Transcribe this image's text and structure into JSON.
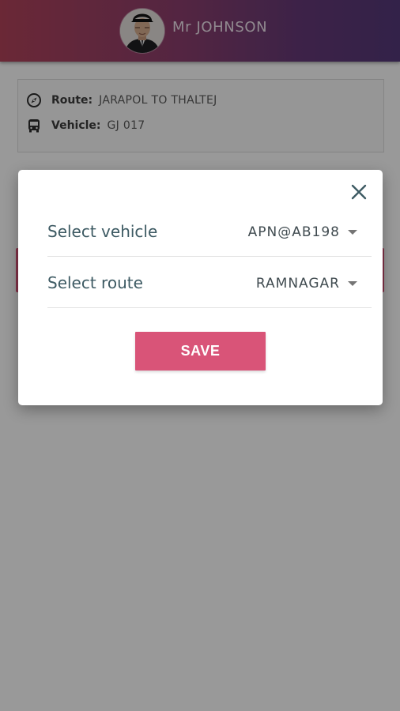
{
  "header": {
    "user_name": "Mr JOHNSON",
    "avatar_icon": "user-avatar-photo",
    "gradient_colors": [
      "#b2435b",
      "#553a7a"
    ]
  },
  "trip": {
    "route_icon": "compass-icon",
    "route_label": "Route:",
    "route_value": "JARAPOL TO THALTEJ",
    "vehicle_icon": "bus-icon",
    "vehicle_label": "Vehicle:",
    "vehicle_value": "GJ 017"
  },
  "dialog": {
    "close_icon": "close-icon",
    "vehicle_label": "Select vehicle",
    "vehicle_selected": "APN@AB198",
    "route_label": "Select route",
    "route_selected": "RAMNAGAR",
    "save_label": "SAVE"
  },
  "colors": {
    "accent": "#d95478",
    "label_text": "#3d5a63",
    "overlay": "rgba(0,0,0,0.40)"
  }
}
